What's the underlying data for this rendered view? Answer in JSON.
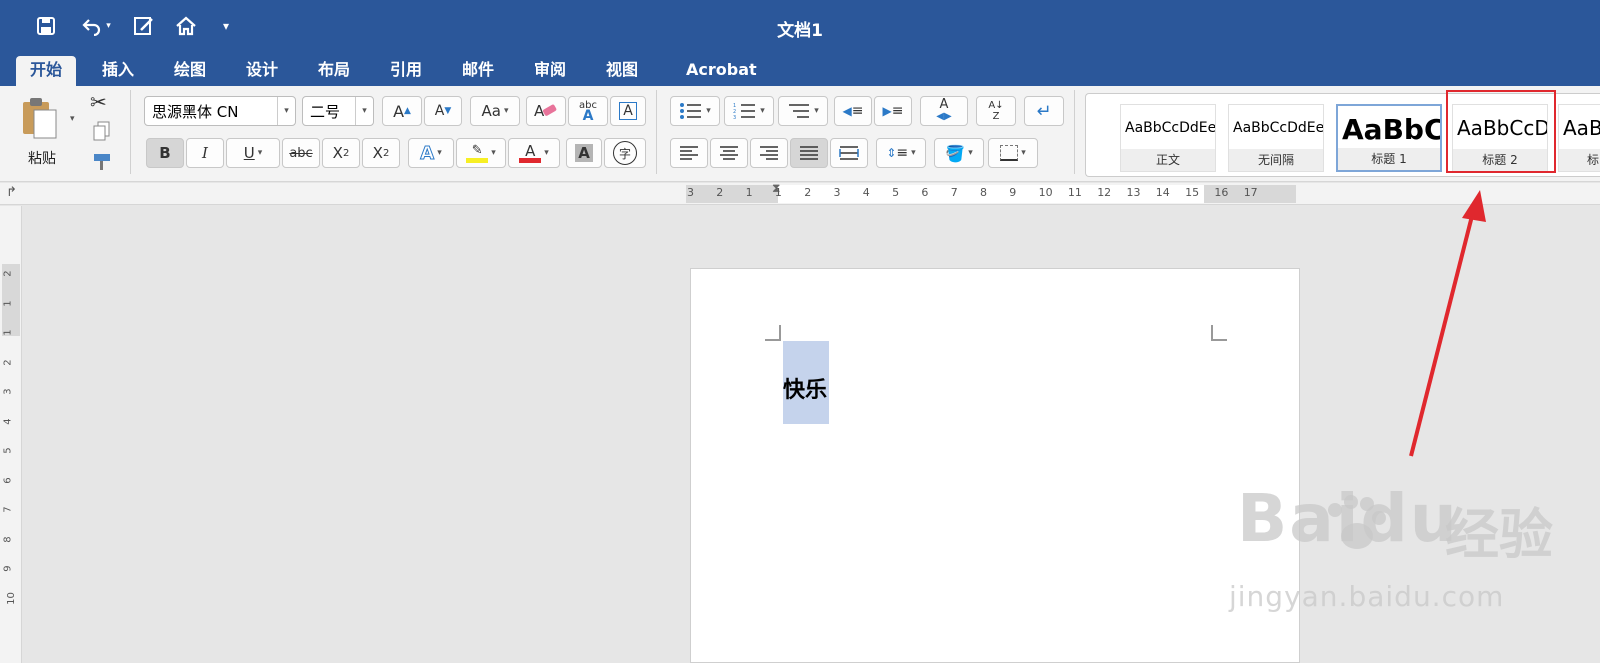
{
  "window": {
    "title": "文档1"
  },
  "tabs": [
    "开始",
    "插入",
    "绘图",
    "设计",
    "布局",
    "引用",
    "邮件",
    "审阅",
    "视图",
    "Acrobat"
  ],
  "clipboard": {
    "paste_label": "粘贴"
  },
  "font": {
    "name": "思源黑体 CN",
    "size": "二号"
  },
  "styles": [
    {
      "sample": "AaBbCcDdEe",
      "label": "正文"
    },
    {
      "sample": "AaBbCcDdEe",
      "label": "无间隔"
    },
    {
      "sample": "AaBbC",
      "label": "标题 1"
    },
    {
      "sample": "AaBbCcD",
      "label": "标题 2"
    },
    {
      "sample": "AaB",
      "label": "标"
    }
  ],
  "ruler": {
    "h_ticks": [
      "3",
      "2",
      "1",
      "1",
      "2",
      "3",
      "4",
      "5",
      "6",
      "7",
      "8",
      "9",
      "10",
      "11",
      "12",
      "13",
      "14",
      "15",
      "16",
      "17"
    ],
    "v_ticks": [
      "2",
      "1",
      "1",
      "2",
      "3",
      "4",
      "5",
      "6",
      "7",
      "8",
      "9",
      "10"
    ]
  },
  "document": {
    "text": "快乐"
  },
  "watermark": {
    "brand": "Baidu",
    "cn": "经验",
    "url": "jingyan.baidu.com"
  },
  "colors": {
    "accent": "#2b579a",
    "annotation": "#e0282e",
    "selection": "#c5d3ec"
  }
}
